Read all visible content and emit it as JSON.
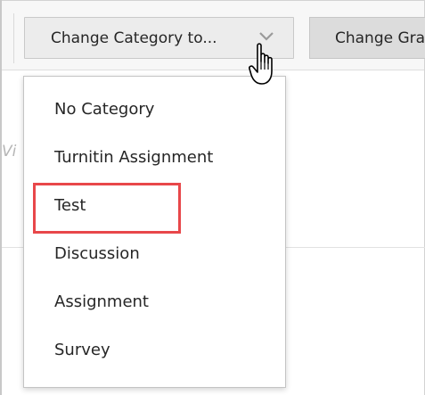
{
  "toolbar": {
    "category_button_label": "Change Category to...",
    "second_button_label": "Change Grade"
  },
  "menu": {
    "items": [
      {
        "label": "No Category"
      },
      {
        "label": "Turnitin Assignment"
      },
      {
        "label": "Test",
        "highlighted": true
      },
      {
        "label": "Discussion"
      },
      {
        "label": "Assignment"
      },
      {
        "label": "Survey"
      }
    ]
  },
  "page": {
    "background_fragment": "Vi"
  },
  "colors": {
    "highlight": "#e8474a",
    "button_bg": "#ececec",
    "menu_border": "#c4c4c4"
  }
}
